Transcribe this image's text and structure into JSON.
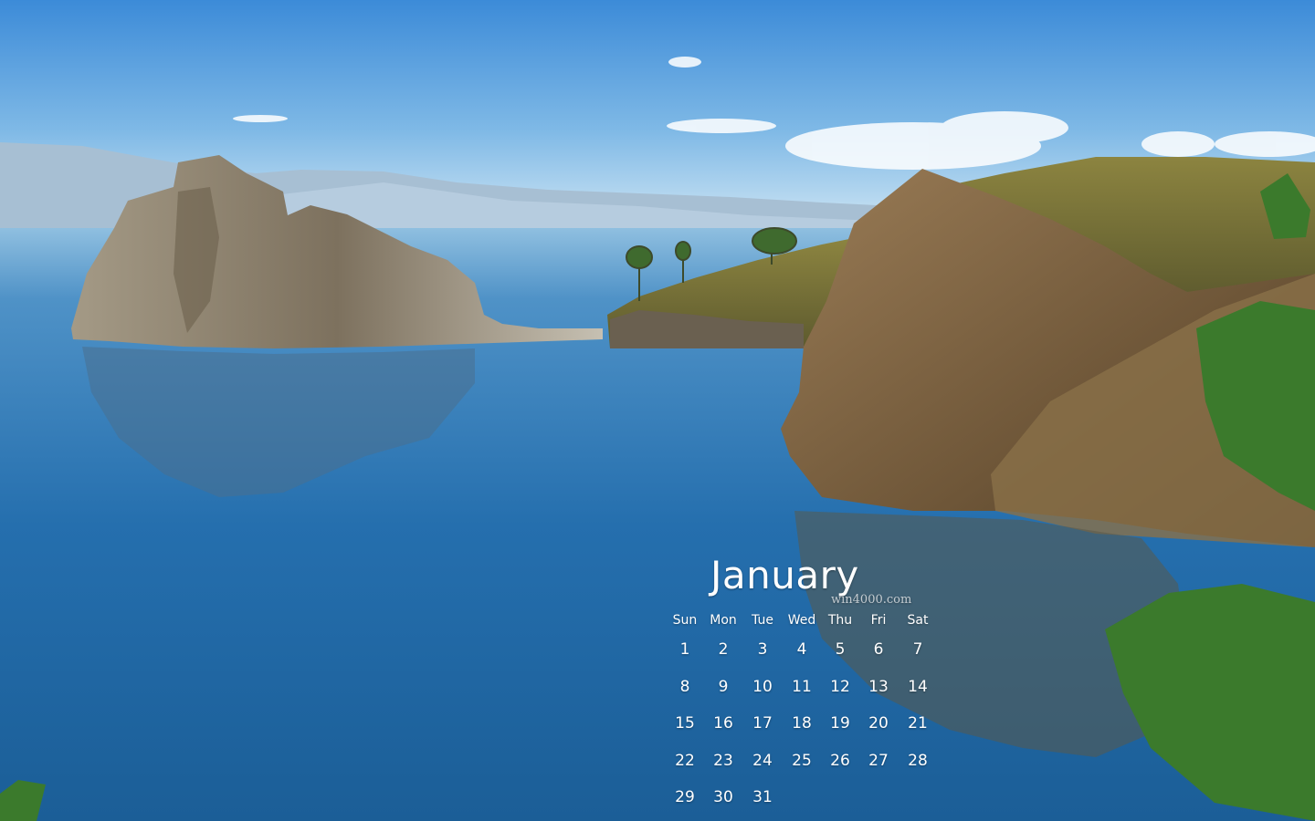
{
  "calendar": {
    "month": "January",
    "watermark": "win4000.com",
    "weekdays": [
      "Sun",
      "Mon",
      "Tue",
      "Wed",
      "Thu",
      "Fri",
      "Sat"
    ],
    "weeks": [
      [
        "1",
        "2",
        "3",
        "4",
        "5",
        "6",
        "7"
      ],
      [
        "8",
        "9",
        "10",
        "11",
        "12",
        "13",
        "14"
      ],
      [
        "15",
        "16",
        "17",
        "18",
        "19",
        "20",
        "21"
      ],
      [
        "22",
        "23",
        "24",
        "25",
        "26",
        "27",
        "28"
      ],
      [
        "29",
        "30",
        "31",
        "",
        "",
        "",
        ""
      ]
    ]
  },
  "colors": {
    "sky_top": "#3f8fdc",
    "sky_horizon": "#cfe6f5",
    "water": "#1d5f98",
    "rock": "#8a7a5c",
    "grass": "#7d7a3a",
    "tree": "#3f7a2e"
  }
}
